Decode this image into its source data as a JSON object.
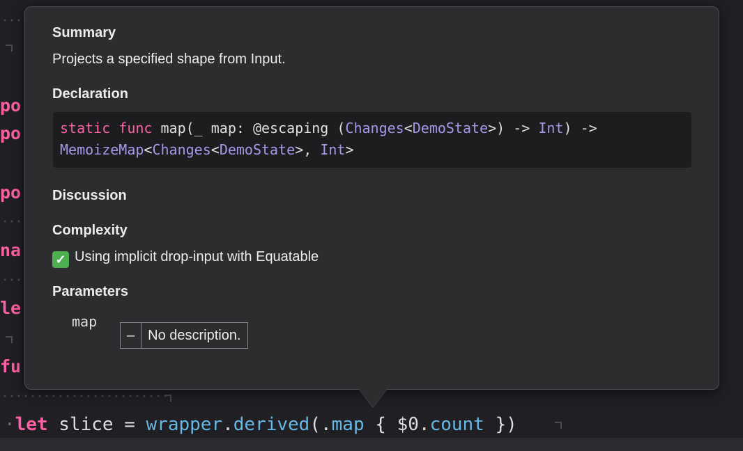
{
  "editor": {
    "gutter_fragments": [
      "po",
      "po",
      "po",
      "na",
      "le",
      "fu"
    ],
    "code_line": {
      "keyword": "let",
      "name": "slice",
      "equals": "=",
      "receiver": "wrapper",
      "method": "derived",
      "open": "(.",
      "member": "map",
      "brace_open": "{",
      "arg": "$0",
      "prop": "count",
      "close": "})"
    }
  },
  "popover": {
    "summary_title": "Summary",
    "summary_text": "Projects a specified shape from Input.",
    "declaration_title": "Declaration",
    "declaration": {
      "line1": {
        "kw1": "static",
        "kw2": "func",
        "name": "map(_ map: @escaping (",
        "t1": "Changes",
        "p1": "<",
        "t2": "DemoState",
        "p2": ">) -> ",
        "t3": "Int",
        "p3": ") ->"
      },
      "line2": {
        "t1": "MemoizeMap",
        "p1": "<",
        "t2": "Changes",
        "p2": "<",
        "t3": "DemoState",
        "p3": ">, ",
        "t4": "Int",
        "p4": ">"
      }
    },
    "discussion_title": "Discussion",
    "complexity_title": "Complexity",
    "complexity_check": "✓",
    "complexity_text": "Using implicit drop-input with Equatable",
    "parameters_title": "Parameters",
    "parameters": [
      {
        "name": "map",
        "dash": "–",
        "description": "No description."
      }
    ]
  }
}
